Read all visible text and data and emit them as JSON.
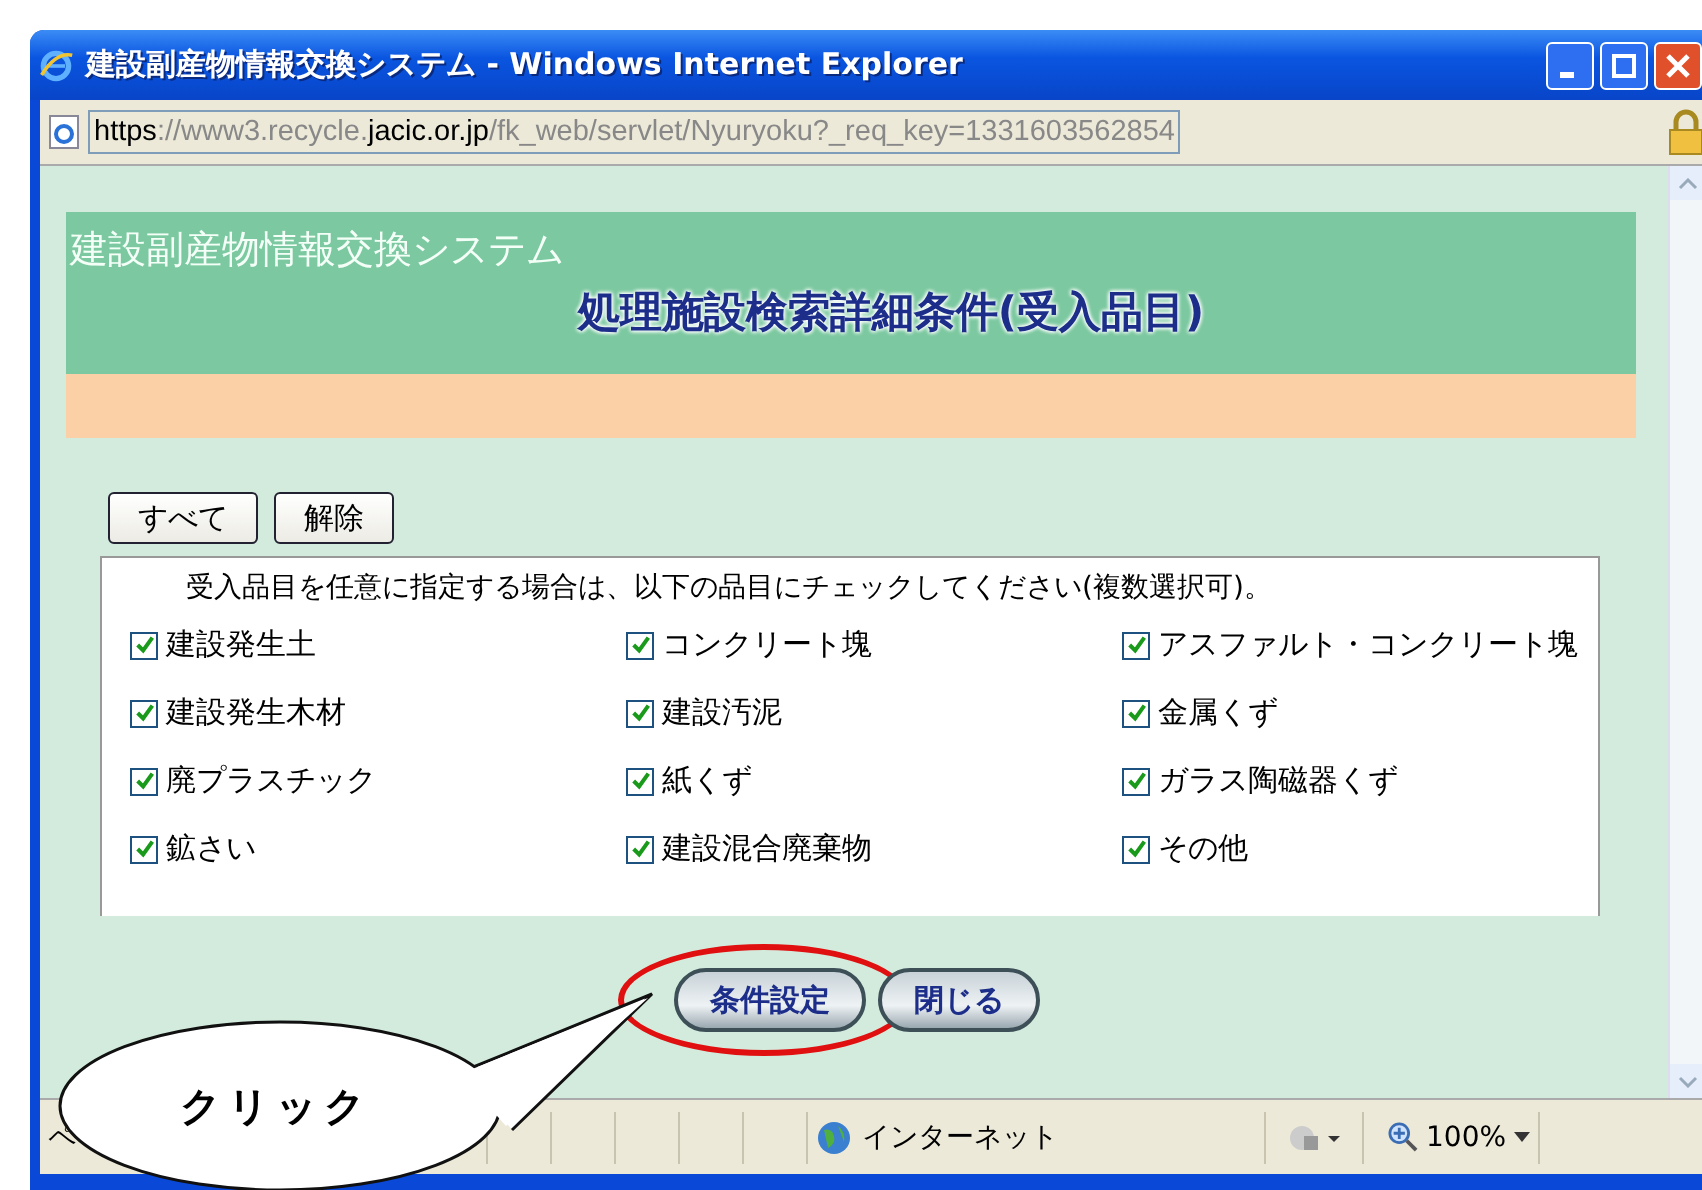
{
  "window": {
    "title": "建設副産物情報交換システム - Windows Internet Explorer"
  },
  "address_bar": {
    "url_parts": [
      {
        "text": "https",
        "emphasis": true
      },
      {
        "text": "://www3.recycle.",
        "emphasis": false
      },
      {
        "text": "jacic.or.jp",
        "emphasis": true
      },
      {
        "text": "/fk_web/servlet/Nyuryoku?_req_key=1331603562854",
        "emphasis": false
      }
    ]
  },
  "header": {
    "system_name": "建設副産物情報交換システム",
    "page_title": "処理施設検索詳細条件(受入品目)"
  },
  "select_buttons": [
    "すべて",
    "解除"
  ],
  "instructions": "受入品目を任意に指定する場合は、以下の品目にチェックしてください(複数選択可)。",
  "items": [
    {
      "label": "建設発生土",
      "checked": true
    },
    {
      "label": "コンクリート塊",
      "checked": true
    },
    {
      "label": "アスファルト・コンクリート塊",
      "checked": true
    },
    {
      "label": "建設発生木材",
      "checked": true
    },
    {
      "label": "建設汚泥",
      "checked": true
    },
    {
      "label": "金属くず",
      "checked": true
    },
    {
      "label": "廃プラスチック",
      "checked": true
    },
    {
      "label": "紙くず",
      "checked": true
    },
    {
      "label": "ガラス陶磁器くず",
      "checked": true
    },
    {
      "label": "鉱さい",
      "checked": true
    },
    {
      "label": "建設混合廃棄物",
      "checked": true
    },
    {
      "label": "その他",
      "checked": true
    }
  ],
  "action_buttons": [
    {
      "label": "条件設定",
      "highlighted": true
    },
    {
      "label": "閉じる",
      "highlighted": false
    }
  ],
  "status_bar": {
    "left_text": "ペ",
    "zone": "インターネット",
    "zoom": "100%"
  },
  "callout": {
    "text": "クリック"
  }
}
